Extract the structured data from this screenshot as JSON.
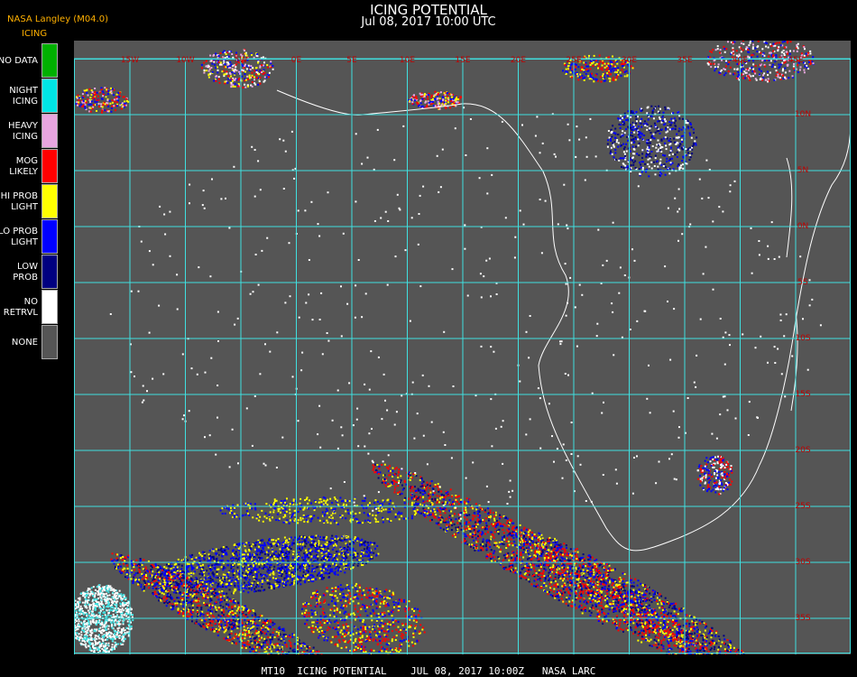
{
  "header": {
    "title": "ICING POTENTIAL",
    "subtitle": "Jul 08, 2017 10:00 UTC",
    "provider": "NASA Langley (M04.0)",
    "product": "ICING"
  },
  "legend": [
    {
      "label": "NO DATA",
      "color": "#00b000"
    },
    {
      "label": "NIGHT\nICING",
      "color": "#00e5e5"
    },
    {
      "label": "HEAVY\nICING",
      "color": "#e8a6e0"
    },
    {
      "label": "MOG\nLIKELY",
      "color": "#ff0000"
    },
    {
      "label": "HI PROB\nLIGHT",
      "color": "#ffff00"
    },
    {
      "label": "LO PROB\nLIGHT",
      "color": "#0000ff"
    },
    {
      "label": "LOW\nPROB",
      "color": "#000080"
    },
    {
      "label": "NO\nRETRVL",
      "color": "#ffffff"
    },
    {
      "label": "NONE",
      "color": "#555555"
    }
  ],
  "map": {
    "background": "#555555",
    "grid_color": "#40e0e0",
    "coast_color": "#ffffff",
    "label_color": "#c00000",
    "top_labels": [
      "15W",
      "10W",
      "5W",
      "0E",
      "5E",
      "10E",
      "15E",
      "20E",
      "25E",
      "30E",
      "35E",
      "40E",
      "45E"
    ],
    "right_labels": [
      "10N",
      "5N",
      "0N",
      "5S",
      "10S",
      "15S",
      "20S",
      "25S",
      "30S",
      "35S",
      "40S"
    ]
  },
  "footer": {
    "text": "MT10  ICING POTENTIAL    JUL 08, 2017 10:00Z   NASA LARC"
  }
}
